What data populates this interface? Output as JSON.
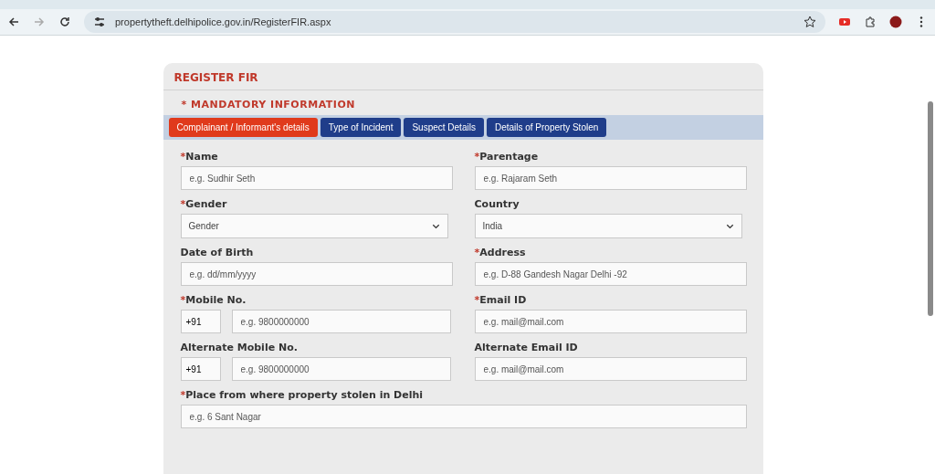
{
  "browser": {
    "url": "propertytheft.delhipolice.gov.in/RegisterFIR.aspx"
  },
  "form": {
    "title": "REGISTER FIR",
    "mandatory_note": "* MANDATORY INFORMATION",
    "tabs": [
      {
        "label": "Complainant / Informant's details",
        "selected": true
      },
      {
        "label": "Type of Incident",
        "selected": false
      },
      {
        "label": "Suspect Details",
        "selected": false
      },
      {
        "label": "Details of Property Stolen",
        "selected": false
      }
    ],
    "fields": [
      {
        "label": "Name",
        "mark": "*",
        "kind": "text",
        "placeholder": "e.g. Sudhir Seth"
      },
      {
        "label": "Parentage",
        "mark": "*",
        "kind": "text",
        "placeholder": "e.g. Rajaram Seth"
      },
      {
        "label": "Gender",
        "mark": "*",
        "kind": "select",
        "value": "Gender"
      },
      {
        "label": "Country",
        "kind": "select",
        "value": "India"
      },
      {
        "label": "Date of Birth",
        "kind": "text",
        "placeholder": "e.g. dd/mm/yyyy"
      },
      {
        "label": "Address",
        "mark": "*",
        "kind": "text",
        "placeholder": "e.g. D-88 Gandesh Nagar Delhi -92"
      },
      {
        "label": "Mobile No.",
        "mark": "*",
        "kind": "phone",
        "prefix": "+91",
        "placeholder": "e.g. 9800000000"
      },
      {
        "label": "Email ID",
        "mark": "*",
        "kind": "text",
        "placeholder": "e.g. mail@mail.com"
      },
      {
        "label": "Alternate Mobile No.",
        "kind": "phone",
        "prefix": "+91",
        "placeholder": "e.g. 9800000000"
      },
      {
        "label": "Alternate Email ID",
        "kind": "text",
        "placeholder": "e.g. mail@mail.com"
      },
      {
        "label": "Place from where property stolen in Delhi",
        "mark": "*",
        "kind": "wide",
        "placeholder": "e.g. 6 Sant Nagar"
      }
    ]
  }
}
